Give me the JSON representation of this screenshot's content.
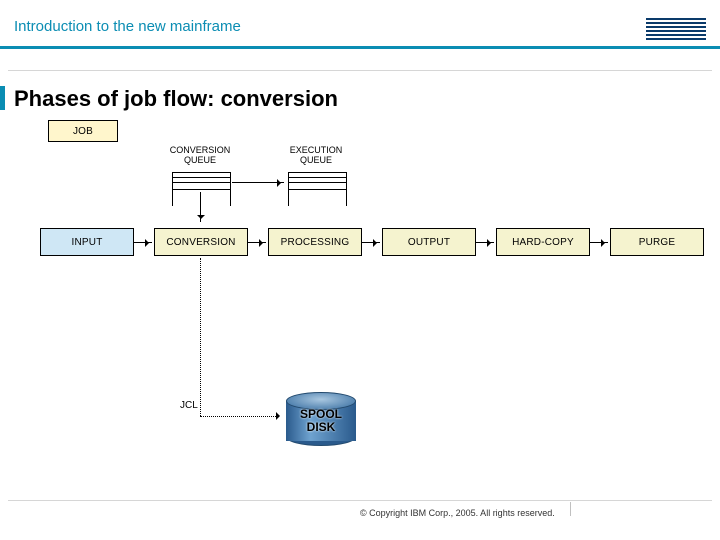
{
  "header": {
    "title": "Introduction to the new mainframe",
    "logo_name": "IBM"
  },
  "title": "Phases of job flow: conversion",
  "diagram": {
    "job_box": "JOB",
    "conv_queue": "CONVERSION\nQUEUE",
    "exec_queue": "EXECUTION\nQUEUE",
    "phases": {
      "input": "INPUT",
      "conversion": "CONVERSION",
      "processing": "PROCESSING",
      "output": "OUTPUT",
      "hardcopy": "HARD-COPY",
      "purge": "PURGE"
    },
    "jcl_label": "JCL",
    "spool": "SPOOL\nDISK"
  },
  "footer": {
    "copyright": "© Copyright IBM Corp., 2005. All rights reserved."
  }
}
